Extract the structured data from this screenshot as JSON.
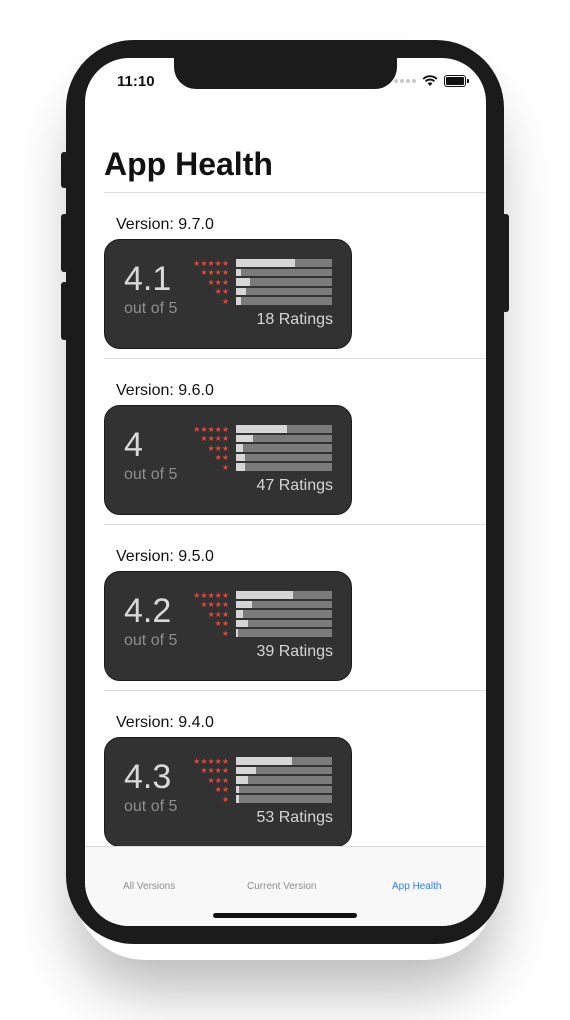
{
  "status": {
    "time": "11:10"
  },
  "nav": {
    "title": "App Health"
  },
  "versions": [
    {
      "label": "Version: 9.7.0",
      "average": "4.1",
      "out_of": "out of 5",
      "ratings": "18 Ratings",
      "distribution": [
        0.61,
        0.05,
        0.15,
        0.1,
        0.05
      ]
    },
    {
      "label": "Version: 9.6.0",
      "average": "4",
      "out_of": "out of 5",
      "ratings": "47 Ratings",
      "distribution": [
        0.53,
        0.18,
        0.07,
        0.09,
        0.09
      ]
    },
    {
      "label": "Version: 9.5.0",
      "average": "4.2",
      "out_of": "out of 5",
      "ratings": "39 Ratings",
      "distribution": [
        0.59,
        0.17,
        0.07,
        0.12,
        0.02
      ]
    },
    {
      "label": "Version: 9.4.0",
      "average": "4.3",
      "out_of": "out of 5",
      "ratings": "53 Ratings",
      "distribution": [
        0.58,
        0.21,
        0.12,
        0.03,
        0.03
      ]
    }
  ],
  "star_rows": [
    "★★★★★",
    "★★★★",
    "★★★",
    "★★",
    "★"
  ],
  "tabs": [
    {
      "label": "All Versions"
    },
    {
      "label": "Current Version"
    },
    {
      "label": "App Health"
    }
  ],
  "colors": {
    "accent": "#2f7cf6",
    "star": "#e5483a",
    "card": "#323232"
  }
}
